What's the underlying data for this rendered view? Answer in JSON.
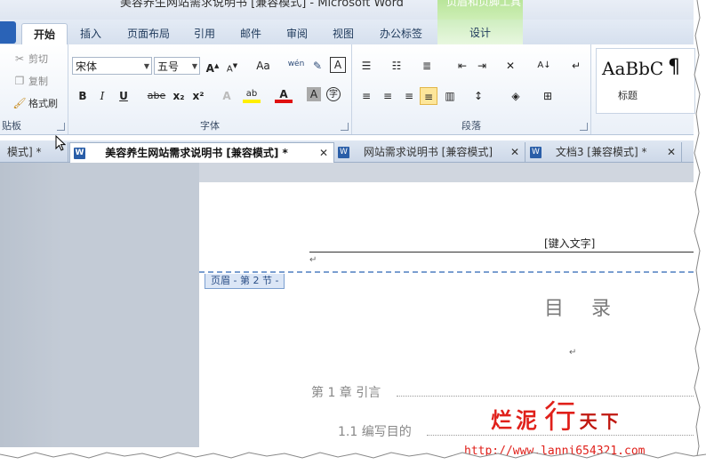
{
  "window": {
    "title": "美容养生网站需求说明书 [兼容模式] - Microsoft Word",
    "context_tab_group": "页眉和页脚工具"
  },
  "tabs": [
    {
      "label": "开始",
      "active": true
    },
    {
      "label": "插入"
    },
    {
      "label": "页面布局"
    },
    {
      "label": "引用"
    },
    {
      "label": "邮件"
    },
    {
      "label": "审阅"
    },
    {
      "label": "视图"
    },
    {
      "label": "办公标签"
    },
    {
      "label": "设计"
    }
  ],
  "clipboard": {
    "cut": "剪切",
    "copy": "复制",
    "format_painter": "格式刷",
    "label": "贴板"
  },
  "font": {
    "name": "宋体",
    "size": "五号",
    "label": "字体",
    "bold": "B",
    "italic": "I",
    "underline": "U",
    "strike": "abe",
    "subscript": "x₂",
    "superscript": "x²",
    "grow": "A",
    "shrink": "A",
    "case": "Aa",
    "font_color": "A"
  },
  "paragraph": {
    "label": "段落"
  },
  "styles": {
    "sample": "AaBbC",
    "sample_label": "标题",
    "sample2": "exists"
  },
  "doc_tabs": [
    {
      "label": "模式] *",
      "active": false
    },
    {
      "label": "美容养生网站需求说明书 [兼容模式] *",
      "active": true
    },
    {
      "label": "网站需求说明书 [兼容模式]",
      "active": false
    },
    {
      "label": "文档3 [兼容模式] *",
      "active": false
    }
  ],
  "document": {
    "header_placeholder": "[键入文字]",
    "header_tag": "页眉 - 第 2 节 -",
    "toc_title": "目 录",
    "toc_entries": [
      {
        "text": "第 1 章  引言"
      },
      {
        "text": "1.1 编写目的"
      }
    ]
  },
  "watermark": {
    "text_a": "烂泥",
    "text_b": "行",
    "text_c": "天下",
    "url": "http://www.lanni654321.com"
  }
}
